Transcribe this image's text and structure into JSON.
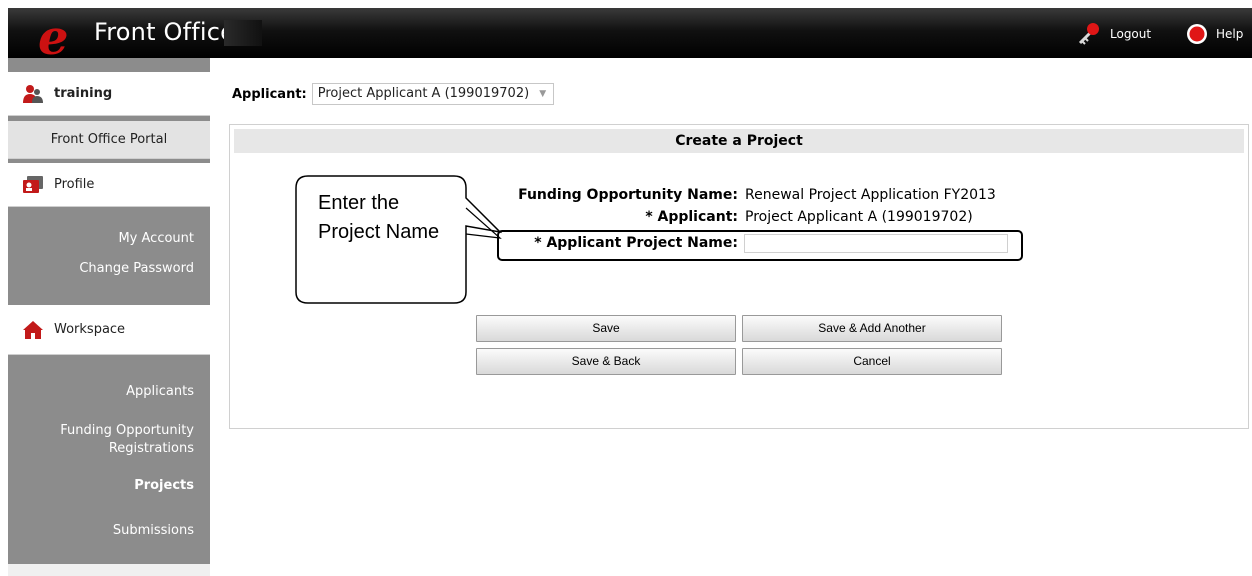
{
  "header": {
    "logo_letter": "e",
    "app_title": "Front Office",
    "logout_label": "Logout",
    "help_label": "Help",
    "bar_color": "#000000",
    "logo_color": "#cc1111"
  },
  "sidebar": {
    "user": {
      "label": "training",
      "icon": "user-group-icon"
    },
    "portal_label": "Front Office Portal",
    "profile": {
      "label": "Profile",
      "icon": "profile-card-icon",
      "links": [
        "My Account",
        "Change Password"
      ]
    },
    "workspace": {
      "label": "Workspace",
      "icon": "home-icon",
      "links": [
        {
          "label": "Applicants"
        },
        {
          "label": "Funding Opportunity Registrations"
        },
        {
          "label": "Projects",
          "active": true
        },
        {
          "label": "Submissions"
        }
      ]
    }
  },
  "applicant_bar": {
    "label": "Applicant:",
    "selected": "Project Applicant A (199019702)"
  },
  "form": {
    "title": "Create a Project",
    "funding_label": "Funding Opportunity Name:",
    "funding_value": "Renewal Project Application FY2013",
    "applicant_label": "* Applicant:",
    "applicant_value": "Project Applicant A (199019702)",
    "project_name_label": "* Applicant Project Name:",
    "project_name_value": "",
    "buttons": {
      "save": "Save",
      "save_add": "Save & Add Another",
      "save_back": "Save & Back",
      "cancel": "Cancel"
    }
  },
  "callout": {
    "text": "Enter the Project Name"
  }
}
